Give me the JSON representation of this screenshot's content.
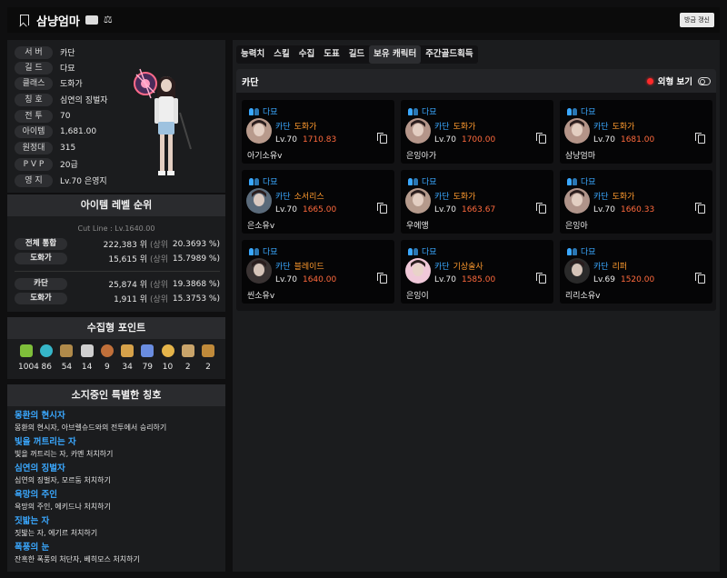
{
  "header": {
    "character_name": "삼냥엄마",
    "refresh_label": "방금 갱신"
  },
  "profile": {
    "rows": [
      {
        "key": "서 버",
        "value": "카단"
      },
      {
        "key": "길 드",
        "value": "다묘"
      },
      {
        "key": "클래스",
        "value": "도화가"
      },
      {
        "key": "칭 호",
        "value": "심연의 징벌자"
      },
      {
        "key": "전 투",
        "value": "70"
      },
      {
        "key": "아이템",
        "value": "1,681.00"
      },
      {
        "key": "원정대",
        "value": "315"
      },
      {
        "key": "P V P",
        "value": "20급"
      },
      {
        "key": "영 지",
        "value": "Lv.70 은영지"
      }
    ]
  },
  "ranking": {
    "title": "아이템 레벨 순위",
    "cutline": "Cut Line : Lv.1640.00",
    "rows": [
      {
        "tag": "전체 통합",
        "rank": "222,383 위",
        "sang": "(상위",
        "pct": "20.3693 %)"
      },
      {
        "tag": "도화가",
        "rank": "15,615 위",
        "sang": "(상위",
        "pct": "15.7989 %)"
      },
      {
        "tag": "카단",
        "rank": "25,874 위",
        "sang": "(상위",
        "pct": "19.3868 %)"
      },
      {
        "tag": "도화가",
        "rank": "1,911 위",
        "sang": "(상위",
        "pct": "15.3753 %)"
      }
    ]
  },
  "collect": {
    "title": "수집형 포인트",
    "items": [
      {
        "icon": "mokoko-seed-icon",
        "color": "#7fbf3a",
        "count": "1004"
      },
      {
        "icon": "island-heart-icon",
        "color": "#36b6c9",
        "count": "86"
      },
      {
        "icon": "great-art-icon",
        "color": "#b08a4a",
        "count": "54"
      },
      {
        "icon": "giant-heart-icon",
        "color": "#cfcfcf",
        "count": "14"
      },
      {
        "icon": "ignea-token-icon",
        "color": "#c0703a",
        "count": "9"
      },
      {
        "icon": "orpheus-star-icon",
        "color": "#d6a24a",
        "count": "34"
      },
      {
        "icon": "world-tree-leaf-icon",
        "color": "#6a8de0",
        "count": "79"
      },
      {
        "icon": "sea-bounty-icon",
        "color": "#e5b44a",
        "count": "10"
      },
      {
        "icon": "omnium-star-icon",
        "color": "#c9a46a",
        "count": "2"
      },
      {
        "icon": "music-box-icon",
        "color": "#c08a3a",
        "count": "2"
      }
    ]
  },
  "titles": {
    "title": "소지중인 특별한 칭호",
    "items": [
      {
        "name": "몽환의 현시자",
        "desc": "몽환의 현시자, 아브렐슈드와의 전투에서 승리하기"
      },
      {
        "name": "빛을 꺼트리는 자",
        "desc": "빛을 꺼트리는 자, 카멘 처치하기"
      },
      {
        "name": "심연의 징벌자",
        "desc": "심연의 징벌자, 모르둠 처치하기"
      },
      {
        "name": "욕망의 주인",
        "desc": "욕망의 주인, 에키드나 처치하기"
      },
      {
        "name": "짓밟는 자",
        "desc": "짓밟는 자, 에기르 처치하기"
      },
      {
        "name": "폭풍의 눈",
        "desc": "잔혹한 폭풍의 처단자, 베히모스 처치하기"
      }
    ]
  },
  "tabs": [
    "능력치",
    "스킬",
    "수집",
    "도표",
    "길드",
    "보유 캐릭터",
    "주간골드획득"
  ],
  "active_tab": "보유 캐릭터",
  "server_section": {
    "server_name": "카단",
    "view_label": "외형 보기"
  },
  "characters": [
    {
      "guild": "다묘",
      "server": "카단",
      "class": "도화가",
      "level": "Lv.70",
      "item_level": "1710.83",
      "name": "아기소유v"
    },
    {
      "guild": "다묘",
      "server": "카단",
      "class": "도화가",
      "level": "Lv.70",
      "item_level": "1700.00",
      "name": "은잉아가"
    },
    {
      "guild": "다묘",
      "server": "카단",
      "class": "도화가",
      "level": "Lv.70",
      "item_level": "1681.00",
      "name": "삼냥엄마"
    },
    {
      "guild": "다묘",
      "server": "카단",
      "class": "소서리스",
      "level": "Lv.70",
      "item_level": "1665.00",
      "name": "은소유v"
    },
    {
      "guild": "다묘",
      "server": "카단",
      "class": "도화가",
      "level": "Lv.70",
      "item_level": "1663.67",
      "name": "우에앵"
    },
    {
      "guild": "다묘",
      "server": "카단",
      "class": "도화가",
      "level": "Lv.70",
      "item_level": "1660.33",
      "name": "은잉아"
    },
    {
      "guild": "다묘",
      "server": "카단",
      "class": "블레이드",
      "level": "Lv.70",
      "item_level": "1640.00",
      "name": "씬소유v"
    },
    {
      "guild": "다묘",
      "server": "카단",
      "class": "기상술사",
      "level": "Lv.70",
      "item_level": "1585.00",
      "name": "은잉이"
    },
    {
      "guild": "다묘",
      "server": "카단",
      "class": "리퍼",
      "level": "Lv.69",
      "item_level": "1520.00",
      "name": "리리소유v"
    }
  ]
}
